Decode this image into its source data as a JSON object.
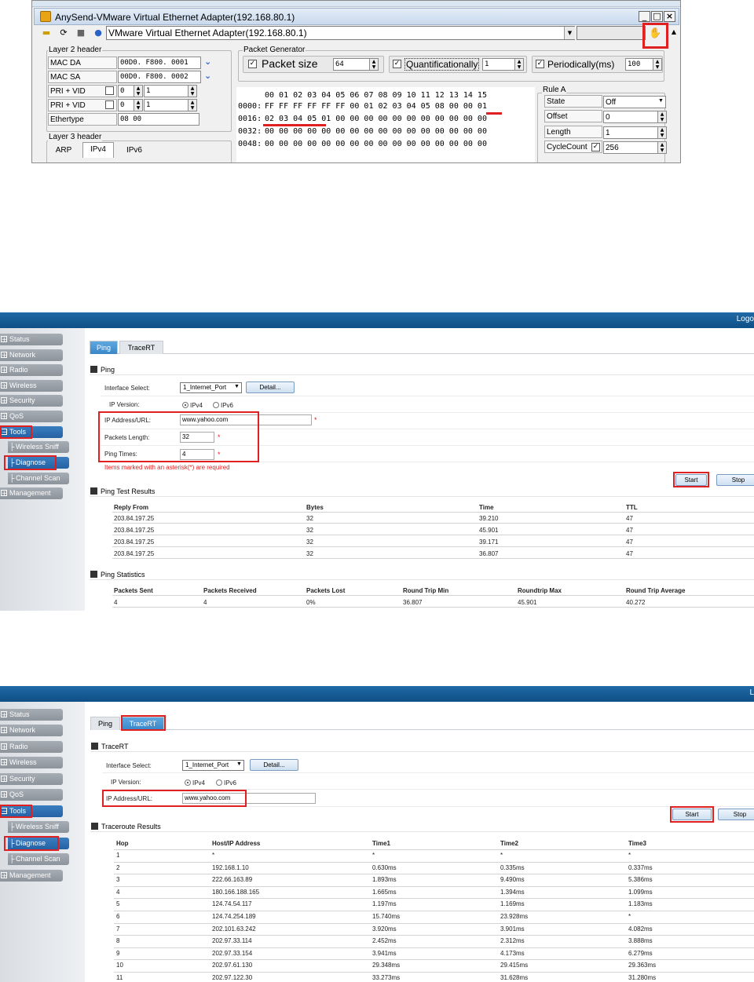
{
  "anysend": {
    "title": "AnySend-VMware Virtual Ethernet Adapter(192.168.80.1)",
    "adapter": "VMware Virtual Ethernet Adapter(192.168.80.1)",
    "window_buttons": [
      "_",
      "□",
      "×"
    ],
    "layer2": {
      "title": "Layer 2 header",
      "rows": [
        {
          "label": "MAC DA",
          "value": "00D0. F800. 0001"
        },
        {
          "label": "MAC SA",
          "value": "00D0. F800. 0002"
        },
        {
          "label": "PRI + VID",
          "v1": "0",
          "v2": "1"
        },
        {
          "label": "PRI + VID",
          "v1": "0",
          "v2": "1"
        },
        {
          "label": "Ethertype",
          "value": "08 00"
        }
      ]
    },
    "layer3": {
      "title": "Layer 3 header",
      "tabs": [
        "ARP",
        "IPv4",
        "IPv6"
      ]
    },
    "packet_generator": {
      "title": "Packet Generator",
      "packet_size_label": "Packet size",
      "packet_size_value": "64",
      "quantificationally_label": "Quantificationally",
      "quantificationally_value": "1",
      "periodically_label": "Periodically(ms)",
      "periodically_value": "100"
    },
    "hex": {
      "header": "00 01 02 03 04 05 06 07 08 09 10 11 12 13 14 15",
      "rows": [
        {
          "offset": "0000:",
          "bytes": "FF FF FF FF FF FF 00 01 02 03 04 05 08 00 00 01"
        },
        {
          "offset": "0016:",
          "bytes": "02 03 04 05 01 00 00 00 00 00 00 00 00 00 00 00"
        },
        {
          "offset": "0032:",
          "bytes": "00 00 00 00 00 00 00 00 00 00 00 00 00 00 00 00"
        },
        {
          "offset": "0048:",
          "bytes": "00 00 00 00 00 00 00 00 00 00 00 00 00 00 00 00"
        }
      ]
    },
    "rule": {
      "title": "Rule A",
      "state_label": "State",
      "state_value": "Off",
      "offset_label": "Offset",
      "offset_value": "0",
      "length_label": "Length",
      "length_value": "1",
      "cyclecount_label": "CycleCount",
      "cyclecount_value": "256"
    }
  },
  "ping_page": {
    "logo": "Logo",
    "nav": [
      "Status",
      "Network",
      "Radio",
      "Wireless",
      "Security",
      "QoS",
      "Tools",
      "Management"
    ],
    "sub_nav": [
      "Wireless Sniff",
      "Diagnose",
      "Channel Scan"
    ],
    "tabs": [
      "Ping",
      "TraceRT"
    ],
    "section_title": "Ping",
    "interface_label": "Interface Select:",
    "interface_value": "1_Internet_Port",
    "detail_button": "Detail...",
    "ip_version_label": "IP Version:",
    "ipv4": "IPv4",
    "ipv6": "IPv6",
    "ip_label": "IP Address/URL:",
    "ip_value": "www.yahoo.com",
    "len_label": "Packets Length:",
    "len_value": "32",
    "times_label": "Ping Times:",
    "times_value": "4",
    "required_note": "Items marked with an asterisk(*) are required",
    "start": "Start",
    "stop": "Stop",
    "results_title": "Ping Test Results",
    "results_headers": [
      "Reply From",
      "Bytes",
      "Time",
      "TTL"
    ],
    "results": [
      [
        "203.84.197.25",
        "32",
        "39.210",
        "47"
      ],
      [
        "203.84.197.25",
        "32",
        "45.901",
        "47"
      ],
      [
        "203.84.197.25",
        "32",
        "39.171",
        "47"
      ],
      [
        "203.84.197.25",
        "32",
        "36.807",
        "47"
      ]
    ],
    "stats_title": "Ping Statistics",
    "stats_headers": [
      "Packets Sent",
      "Packets Received",
      "Packets Lost",
      "Round Trip Min",
      "Roundtrip Max",
      "Round Trip Average"
    ],
    "stats": [
      "4",
      "4",
      "0%",
      "36.807",
      "45.901",
      "40.272"
    ]
  },
  "trace_page": {
    "logo": "L",
    "nav": [
      "Status",
      "Network",
      "Radio",
      "Wireless",
      "Security",
      "QoS",
      "Tools",
      "Management"
    ],
    "sub_nav": [
      "Wireless Sniff",
      "Diagnose",
      "Channel Scan"
    ],
    "tabs": [
      "Ping",
      "TraceRT"
    ],
    "section_title": "TraceRT",
    "interface_label": "Interface Select:",
    "interface_value": "1_Internet_Port",
    "detail_button": "Detail...",
    "ip_version_label": "IP Version:",
    "ipv4": "IPv4",
    "ipv6": "IPv6",
    "ip_label": "IP Address/URL:",
    "ip_value": "www.yahoo.com",
    "start": "Start",
    "stop": "Stop",
    "results_title": "Traceroute Results",
    "headers": [
      "Hop",
      "Host/IP Address",
      "Time1",
      "Time2",
      "Time3"
    ],
    "rows": [
      [
        "1",
        "*",
        "*",
        "*",
        "*"
      ],
      [
        "2",
        "192.168.1.10",
        "0.630ms",
        "0.335ms",
        "0.337ms"
      ],
      [
        "3",
        "222.66.163.89",
        "1.893ms",
        "9.490ms",
        "5.386ms"
      ],
      [
        "4",
        "180.166.188.165",
        "1.665ms",
        "1.394ms",
        "1.099ms"
      ],
      [
        "5",
        "124.74.54.117",
        "1.197ms",
        "1.169ms",
        "1.183ms"
      ],
      [
        "6",
        "124.74.254.189",
        "15.740ms",
        "23.928ms",
        "*"
      ],
      [
        "7",
        "202.101.63.242",
        "3.920ms",
        "3.901ms",
        "4.082ms"
      ],
      [
        "8",
        "202.97.33.114",
        "2.452ms",
        "2.312ms",
        "3.888ms"
      ],
      [
        "9",
        "202.97.33.154",
        "3.941ms",
        "4.173ms",
        "6.279ms"
      ],
      [
        "10",
        "202.97.61.130",
        "29.348ms",
        "29.415ms",
        "29.363ms"
      ],
      [
        "11",
        "202.97.122.30",
        "33.273ms",
        "31.628ms",
        "31.280ms"
      ]
    ]
  }
}
